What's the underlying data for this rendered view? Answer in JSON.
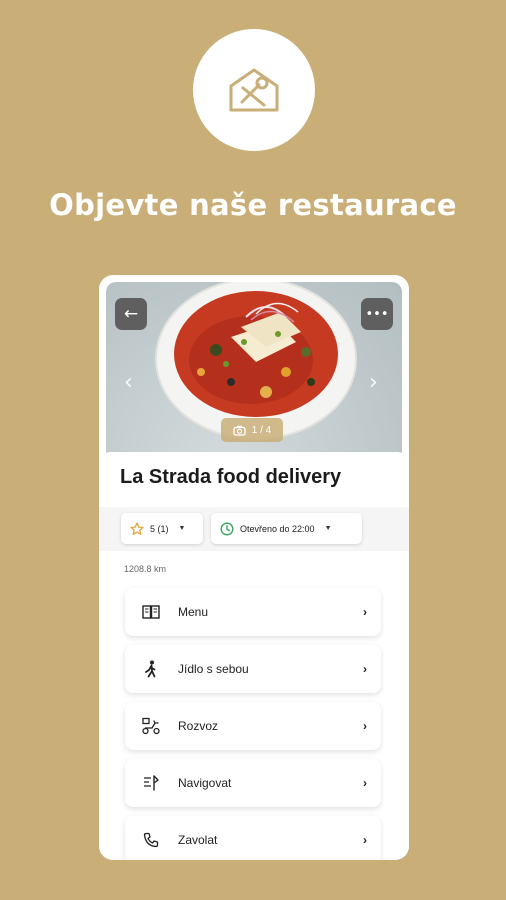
{
  "headline": "Objevte naše restaurace",
  "restaurant": {
    "name": "La Strada food delivery",
    "photo_counter": "1 / 4",
    "rating_chip": "5 (1)",
    "hours_chip": "Otevřeno do 22:00",
    "distance": "1208.8 km"
  },
  "menu_items": [
    {
      "label": "Menu",
      "icon": "book-open-icon"
    },
    {
      "label": "Jídlo s sebou",
      "icon": "walking-person-icon"
    },
    {
      "label": "Rozvoz",
      "icon": "scooter-icon"
    },
    {
      "label": "Navigovat",
      "icon": "directions-icon"
    },
    {
      "label": "Zavolat",
      "icon": "phone-icon"
    }
  ],
  "colors": {
    "background": "#C9AE78",
    "accent": "#C9AE78",
    "star": "#E0A83A",
    "open_green": "#3BA55C"
  }
}
